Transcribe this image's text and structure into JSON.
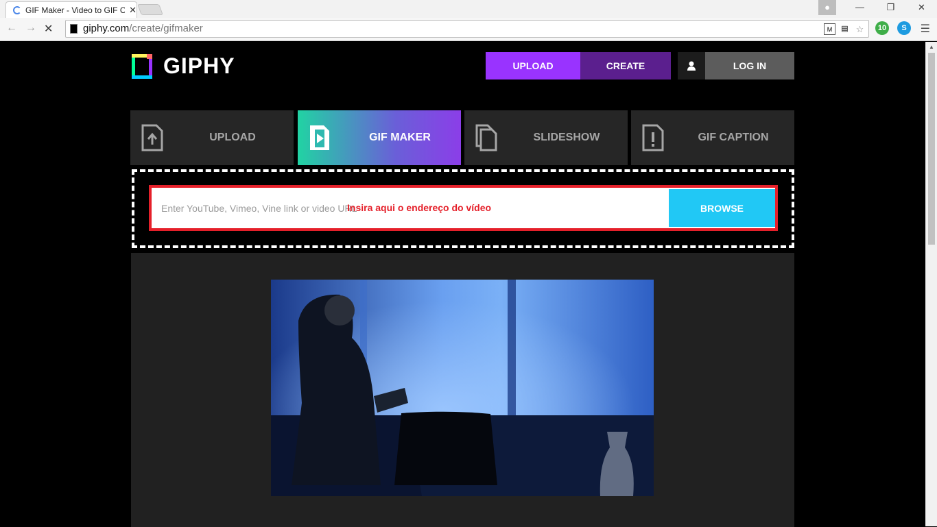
{
  "browser": {
    "tab_title": "GIF Maker - Video to GIF C",
    "tab_close": "✕",
    "url_host": "giphy.com",
    "url_path": "/create/gifmaker",
    "ext_badge": "10"
  },
  "header": {
    "logo_text": "GIPHY",
    "upload_label": "UPLOAD",
    "create_label": "CREATE",
    "login_label": "LOG IN"
  },
  "tabs": [
    {
      "label": "UPLOAD",
      "icon": "file-upload-icon"
    },
    {
      "label": "GIF MAKER",
      "icon": "film-file-icon"
    },
    {
      "label": "SLIDESHOW",
      "icon": "stacked-files-icon"
    },
    {
      "label": "GIF CAPTION",
      "icon": "caption-file-icon"
    }
  ],
  "url_input": {
    "placeholder": "Enter YouTube, Vimeo, Vine link or video URL",
    "overlay_note": "Insira aqui o endereço do vídeo",
    "browse_label": "BROWSE"
  },
  "colors": {
    "upload": "#9933ff",
    "create": "#5b1f8e",
    "browse": "#21c8f5",
    "highlight": "#e5202a"
  }
}
